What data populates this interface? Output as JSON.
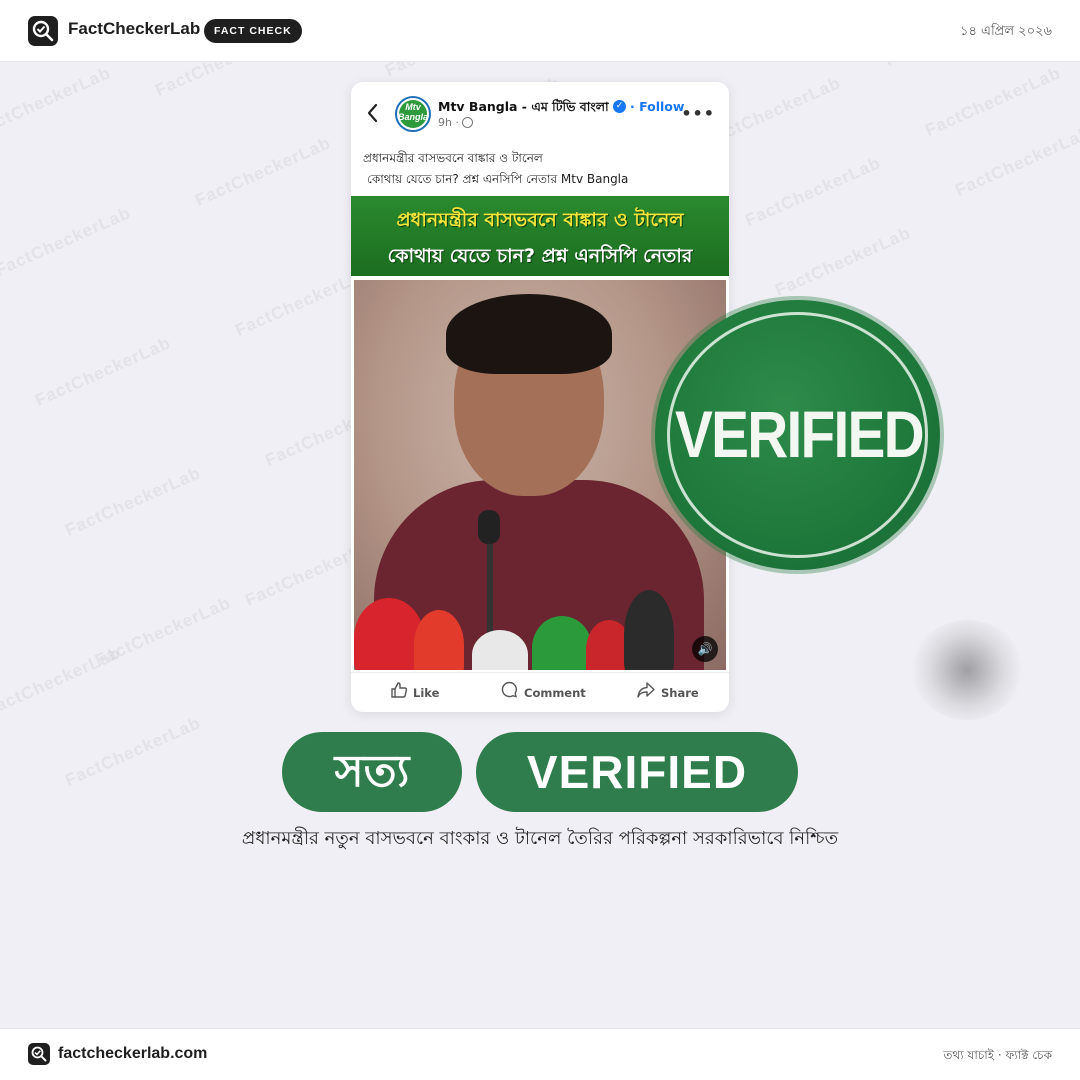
{
  "header": {
    "brand": "FactCheckerLab",
    "badge": "FACT CHECK",
    "date": "১৪ এপ্রিল ২০২৬"
  },
  "watermark": "FactCheckerLab",
  "post": {
    "page_name": "Mtv Bangla - এম টিভি বাংলা",
    "follow_label": "· Follow",
    "time": "9h ·",
    "avatar_text": "Mtv Bangla",
    "caption_line1": "প্রধানমন্ত্রীর বাসভবনে বাঙ্কার ও টানেল",
    "caption_line2": "কোথায় যেতে চান? প্রশ্ন এনসিপি নেতার Mtv Bangla",
    "banner_line1": "প্রধানমন্ত্রীর বাসভবনে বাঙ্কার ও টানেল",
    "banner_line2": "কোথায় যেতে চান? প্রশ্ন এনসিপি নেতার",
    "actions": {
      "like": "Like",
      "comment": "Comment",
      "share": "Share"
    }
  },
  "stamp": {
    "text": "VERIFIED",
    "color": "#1f7a3c"
  },
  "verdict": {
    "bn": "সত্য",
    "en": "VERIFIED",
    "color": "#2f7d4c"
  },
  "claim": "প্রধানমন্ত্রীর নতুন বাসভবনে বাংকার ও টানেল তৈরির পরিকল্পনা সরকারিভাবে নিশ্চিত",
  "footer": {
    "domain": "factcheckerlab.com",
    "tagline": "তথ্য যাচাই · ফ্যাক্ট চেক"
  },
  "icons": [
    "search-check-icon",
    "back-icon",
    "verified-badge-icon",
    "globe-icon",
    "more-icon",
    "sound-icon",
    "like-icon",
    "comment-icon",
    "share-icon"
  ]
}
